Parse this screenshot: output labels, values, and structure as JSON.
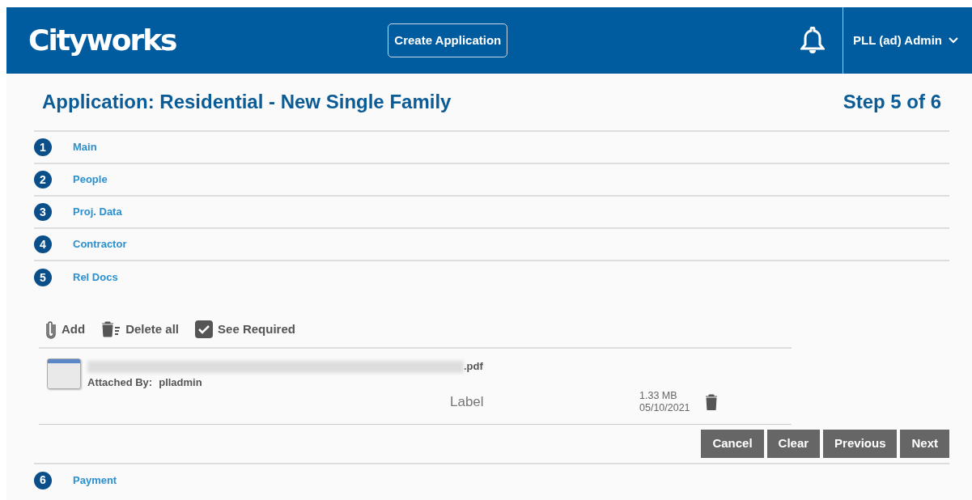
{
  "header": {
    "logo": "Cityworks",
    "create_button": "Create Application",
    "user_menu": "PLL (ad) Admin"
  },
  "title": "Application: Residential - New Single Family",
  "step_counter": "Step 5 of 6",
  "steps": [
    {
      "number": "1",
      "label": "Main"
    },
    {
      "number": "2",
      "label": "People"
    },
    {
      "number": "3",
      "label": "Proj. Data"
    },
    {
      "number": "4",
      "label": "Contractor"
    },
    {
      "number": "5",
      "label": "Rel Docs",
      "panel": {
        "toolbar": [
          {
            "kind": "add",
            "label": "Add"
          },
          {
            "kind": "delete",
            "label": "Delete all"
          },
          {
            "kind": "check",
            "label": "See Required",
            "checked": true
          }
        ],
        "documents": [
          {
            "file_suffix": ".pdf",
            "attached_by_label": "Attached By:",
            "attached_by": "plladmin",
            "label": "Label",
            "size": "1.33 MB",
            "date": "05/10/2021"
          }
        ],
        "buttons": [
          "Cancel",
          "Clear",
          "Previous",
          "Next"
        ]
      }
    },
    {
      "number": "6",
      "label": "Payment"
    }
  ]
}
